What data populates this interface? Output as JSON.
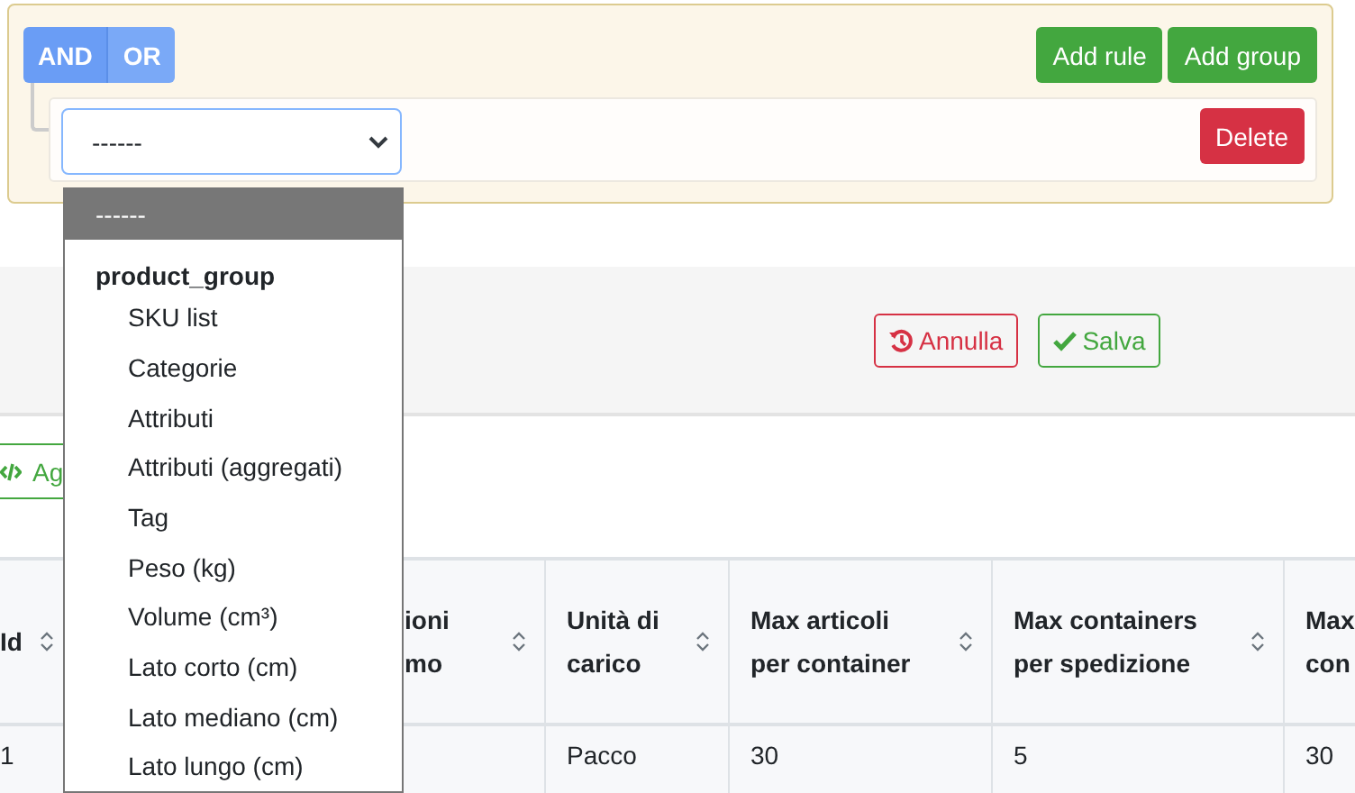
{
  "query_builder": {
    "conditions": [
      {
        "label": "AND",
        "selected": true
      },
      {
        "label": "OR",
        "selected": false
      }
    ],
    "add_rule": "Add rule",
    "add_group": "Add group",
    "rule": {
      "value": "------",
      "delete": "Delete"
    }
  },
  "dropdown": {
    "options": [
      {
        "label": "------",
        "selected": true
      }
    ],
    "groups": [
      {
        "label": "product_group",
        "options": [
          {
            "label": "SKU list",
            "selected": false
          },
          {
            "label": "Categorie",
            "selected": false
          },
          {
            "label": "Attributi",
            "selected": false
          },
          {
            "label": "Attributi (aggregati)",
            "selected": false
          },
          {
            "label": "Tag",
            "selected": false
          },
          {
            "label": "Peso (kg)",
            "selected": false
          },
          {
            "label": "Volume (cm³)",
            "selected": false
          },
          {
            "label": "Lato corto (cm)",
            "selected": false
          },
          {
            "label": "Lato mediano (cm)",
            "selected": false
          },
          {
            "label": "Lato lungo (cm)",
            "selected": false
          }
        ]
      }
    ]
  },
  "toolbar": {
    "cancel": "Annulla",
    "save": "Salva"
  },
  "add_button": "Ag",
  "table": {
    "columns": [
      {
        "lines": [
          "Id"
        ],
        "sortable": true
      },
      {
        "lines": [
          "ioni",
          "mo"
        ],
        "sortable": true
      },
      {
        "lines": [
          "Unità di",
          "carico"
        ],
        "sortable": true
      },
      {
        "lines": [
          "Max articoli",
          "per container"
        ],
        "sortable": true
      },
      {
        "lines": [
          "Max containers",
          "per spedizione"
        ],
        "sortable": true
      },
      {
        "lines": [
          "Max",
          "con"
        ],
        "sortable": false
      }
    ],
    "rows": [
      {
        "cells": [
          "1",
          null,
          "Pacco",
          "30",
          "5",
          "30"
        ]
      }
    ]
  }
}
